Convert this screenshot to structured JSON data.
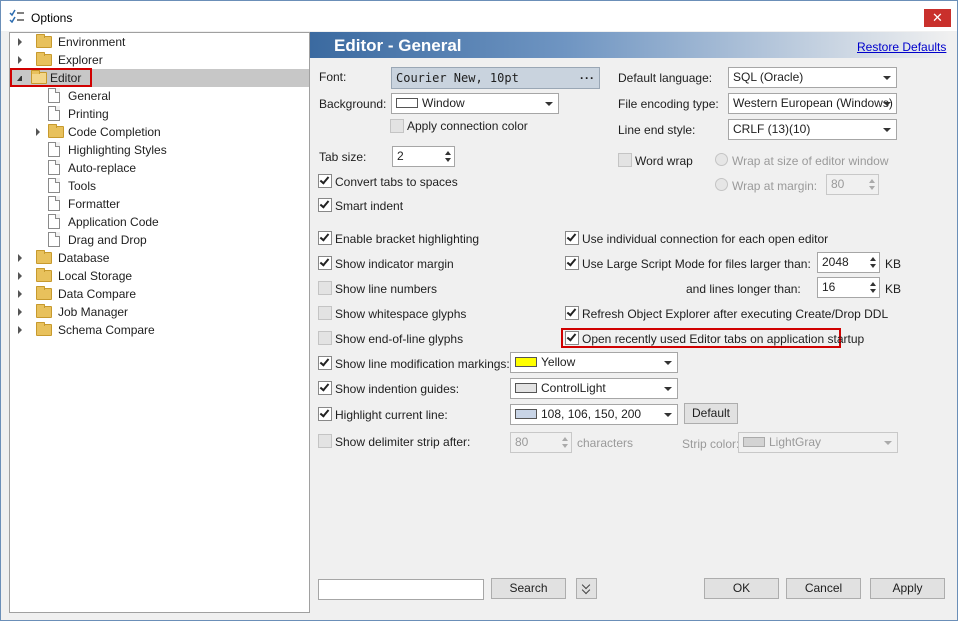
{
  "window": {
    "title": "Options",
    "close_glyph": "✕"
  },
  "tree": {
    "items": [
      {
        "label": "Environment",
        "icon": "folder-icon",
        "state": "collapsed"
      },
      {
        "label": "Explorer",
        "icon": "folder-icon",
        "state": "collapsed"
      },
      {
        "label": "Editor",
        "icon": "folder-open-icon",
        "state": "expanded",
        "selected": true
      },
      {
        "label": "General",
        "icon": "page-icon"
      },
      {
        "label": "Printing",
        "icon": "page-icon"
      },
      {
        "label": "Code Completion",
        "icon": "folder-icon",
        "state": "collapsed"
      },
      {
        "label": "Highlighting Styles",
        "icon": "page-icon"
      },
      {
        "label": "Auto-replace",
        "icon": "page-icon"
      },
      {
        "label": "Tools",
        "icon": "page-icon"
      },
      {
        "label": "Formatter",
        "icon": "page-icon"
      },
      {
        "label": "Application Code",
        "icon": "page-icon"
      },
      {
        "label": "Drag and Drop",
        "icon": "page-icon"
      },
      {
        "label": "Database",
        "icon": "folder-icon",
        "state": "collapsed"
      },
      {
        "label": "Local Storage",
        "icon": "folder-icon",
        "state": "collapsed"
      },
      {
        "label": "Data Compare",
        "icon": "folder-icon",
        "state": "collapsed"
      },
      {
        "label": "Job Manager",
        "icon": "folder-icon",
        "state": "collapsed"
      },
      {
        "label": "Schema Compare",
        "icon": "folder-icon",
        "state": "collapsed"
      }
    ]
  },
  "panel": {
    "title": "Editor - General",
    "restore_defaults": "Restore Defaults",
    "font": {
      "label": "Font:",
      "value": "Courier New, 10pt",
      "ellipsis": "···"
    },
    "background": {
      "label": "Background:",
      "value": "Window",
      "swatch": "#ffffff"
    },
    "apply_connection_color": {
      "label": "Apply connection color",
      "checked": false
    },
    "tab_size": {
      "label": "Tab size:",
      "value": "2"
    },
    "convert_tabs": {
      "label": "Convert tabs to spaces",
      "checked": true
    },
    "smart_indent": {
      "label": "Smart indent",
      "checked": true
    },
    "default_language": {
      "label": "Default language:",
      "value": "SQL (Oracle)"
    },
    "file_encoding": {
      "label": "File encoding type:",
      "value": "Western European (Windows)"
    },
    "line_end": {
      "label": "Line end style:",
      "value": "CRLF (13)(10)"
    },
    "word_wrap": {
      "label": "Word wrap",
      "checked": false
    },
    "wrap_window": {
      "label": "Wrap at size of editor window"
    },
    "wrap_margin": {
      "label": "Wrap at margin:",
      "value": "80"
    },
    "bracket_highlighting": {
      "label": "Enable bracket highlighting",
      "checked": true
    },
    "indicator_margin": {
      "label": "Show indicator margin",
      "checked": true
    },
    "line_numbers": {
      "label": "Show line numbers",
      "checked": false
    },
    "whitespace_glyphs": {
      "label": "Show whitespace glyphs",
      "checked": false
    },
    "eol_glyphs": {
      "label": "Show end-of-line glyphs",
      "checked": false
    },
    "individual_connection": {
      "label": "Use individual connection for each open editor",
      "checked": true
    },
    "large_script": {
      "label": "Use Large Script Mode for files larger than:",
      "value": "2048",
      "unit": "KB",
      "checked": true
    },
    "lines_longer": {
      "label": "and lines longer than:",
      "value": "16",
      "unit": "KB"
    },
    "refresh_explorer": {
      "label": "Refresh Object Explorer after executing Create/Drop DDL",
      "checked": true
    },
    "open_recent_tabs": {
      "label": "Open recently used Editor tabs on application startup",
      "checked": true
    },
    "line_mod_markings": {
      "label": "Show line modification markings:",
      "checked": true,
      "color_name": "Yellow",
      "swatch": "#ffff00"
    },
    "indention_guides": {
      "label": "Show indention guides:",
      "checked": true,
      "color_name": "ControlLight",
      "swatch": "#e3e3e3"
    },
    "highlight_line": {
      "label": "Highlight current line:",
      "checked": true,
      "color_name": "108, 106, 150, 200",
      "swatch": "#c8d4e6",
      "default_button": "Default"
    },
    "delimiter_strip": {
      "label": "Show delimiter strip after:",
      "checked": false,
      "value": "80",
      "unit": "characters"
    },
    "strip_color": {
      "label": "Strip color:",
      "value": "LightGray",
      "swatch": "#d3d3d3"
    }
  },
  "footer": {
    "search_placeholder": "",
    "search_button": "Search",
    "ok": "OK",
    "cancel": "Cancel",
    "apply": "Apply"
  },
  "colors": {
    "header_blue": "#3b6aa0",
    "highlight_red": "#d00000",
    "link": "#0000cc"
  }
}
